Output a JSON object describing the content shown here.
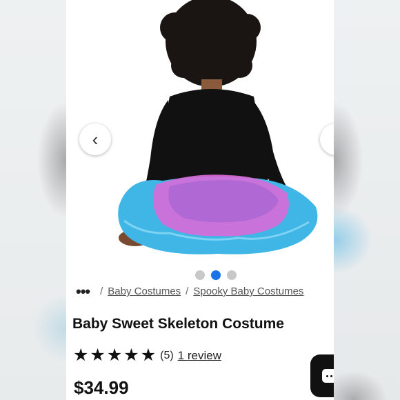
{
  "carousel": {
    "prev_icon": "chevron-left-icon",
    "next_icon": "chevron-right-icon",
    "prev_glyph": "‹",
    "next_glyph": "›",
    "dot_count": 3,
    "active_index": 1
  },
  "breadcrumb": {
    "more": "•••",
    "separator": "/",
    "items": [
      "Baby Costumes",
      "Spooky Baby Costumes"
    ]
  },
  "product": {
    "title": "Baby Sweet Skeleton Costume",
    "rating_stars": 5,
    "rating_count": "(5)",
    "review_link": "1 review",
    "price": "$34.99"
  },
  "colors": {
    "accent": "#1a73e8",
    "tutu_blue": "#3fb6e6",
    "tutu_pink": "#d86bd8",
    "shirt": "#111111"
  },
  "chat": {
    "icon": "chat-icon"
  }
}
